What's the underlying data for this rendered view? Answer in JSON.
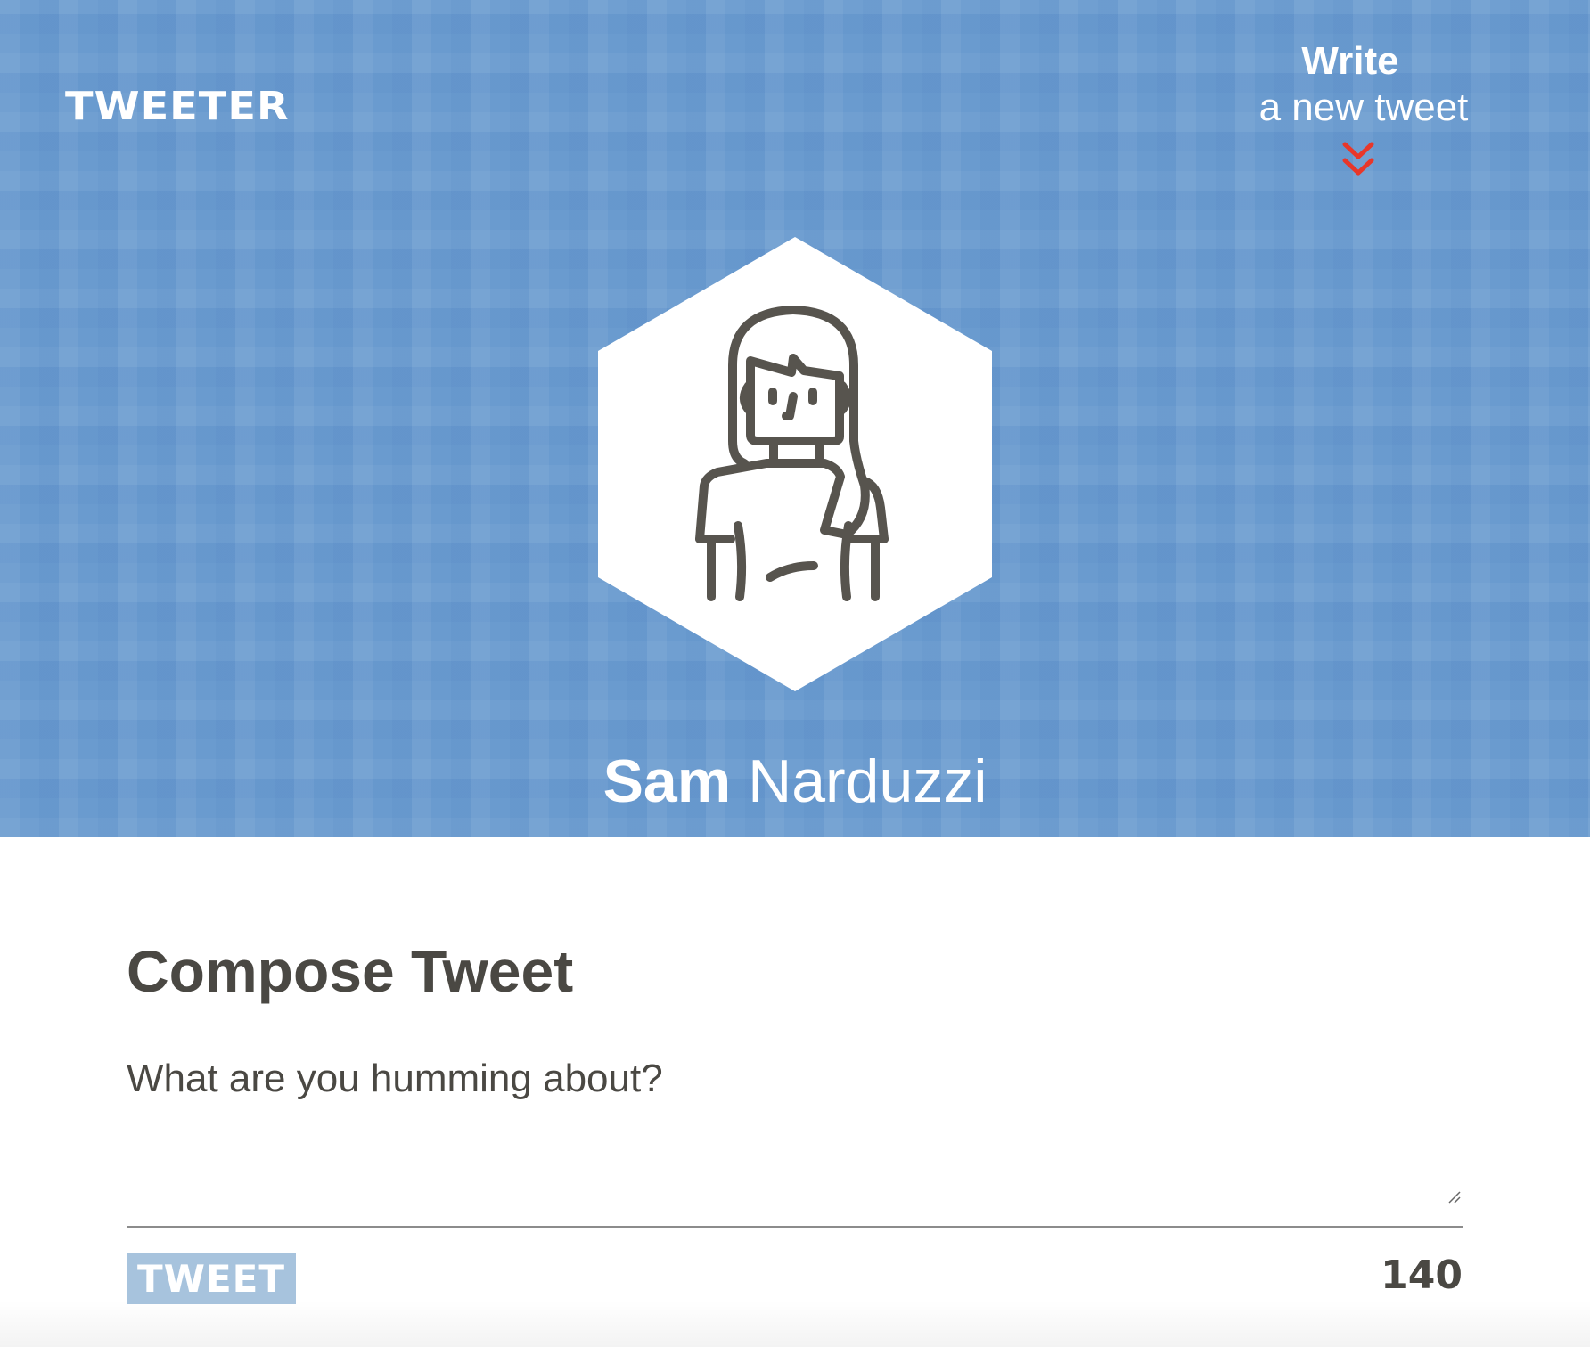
{
  "header": {
    "logo": "TWEETER",
    "write_bold": "Write",
    "write_sub": "a new tweet",
    "scroll_icon": "double-chevron-down-icon"
  },
  "profile": {
    "first_name": "Sam",
    "last_name": "Narduzzi",
    "avatar_icon": "woman-avatar-icon"
  },
  "compose": {
    "title": "Compose Tweet",
    "placeholder": "What are you humming about?",
    "value": "",
    "tweet_button": "TWEET",
    "char_count": "140"
  },
  "colors": {
    "accent": "#6a9bcf",
    "chevron": "#e8372a",
    "text": "#4a4843",
    "button": "#a7c3dd"
  }
}
